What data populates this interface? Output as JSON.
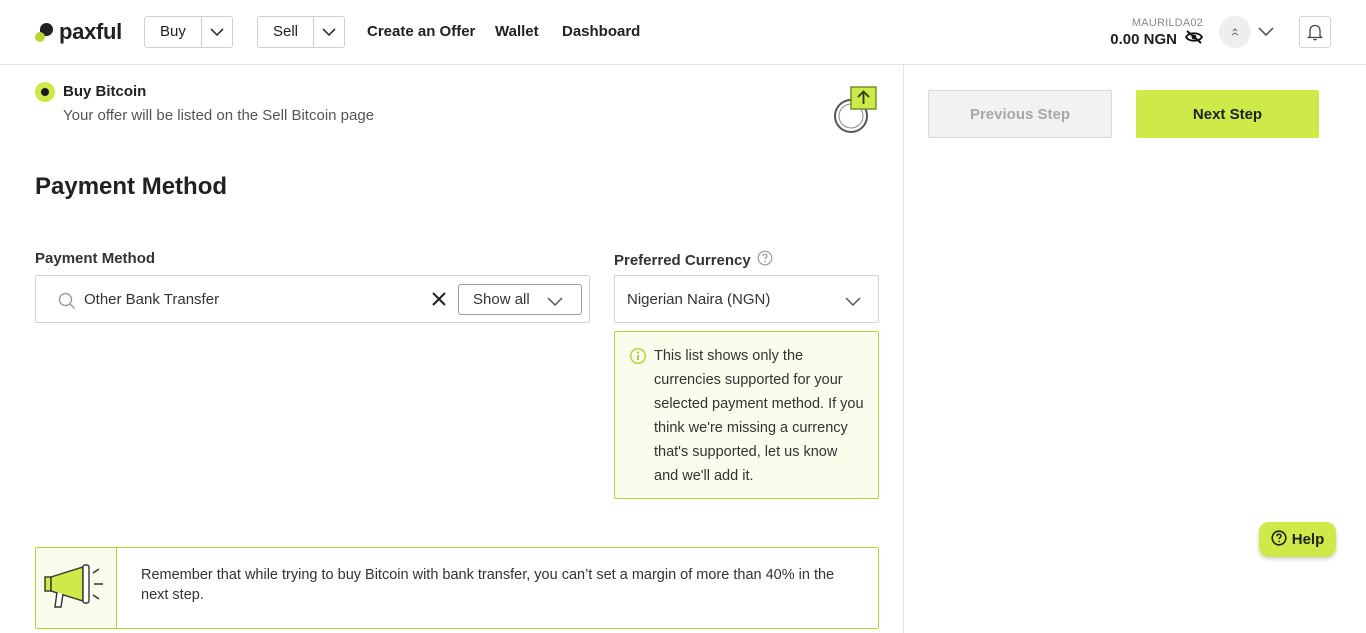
{
  "header": {
    "logo_text": "paxful",
    "buy_label": "Buy",
    "sell_label": "Sell",
    "nav": [
      "Create an Offer",
      "Wallet",
      "Dashboard"
    ],
    "username": "MAURILDA02",
    "balance": "0.00 NGN"
  },
  "offer_type": {
    "label": "Buy Bitcoin",
    "description": "Your offer will be listed on the Sell Bitcoin page",
    "selected": true
  },
  "payment_section": {
    "title": "Payment Method",
    "payment_method_label": "Payment Method",
    "payment_method_value": "Other Bank Transfer",
    "show_all_label": "Show all",
    "preferred_currency_label": "Preferred Currency",
    "preferred_currency_value": "Nigerian Naira (NGN)",
    "info_text": "This list shows only the currencies supported for your selected payment method. If you think we're missing a currency that's supported, let us know and we'll add it."
  },
  "notice": {
    "text": "Remember that while trying to buy Bitcoin with bank transfer, you can’t set a margin of more than 40% in the next step."
  },
  "sidebar": {
    "previous_label": "Previous Step",
    "next_label": "Next Step"
  },
  "help": {
    "label": "Help"
  },
  "colors": {
    "accent": "#cdea48",
    "accent_border": "#b6d43a",
    "info_bg": "#f8fdec"
  }
}
